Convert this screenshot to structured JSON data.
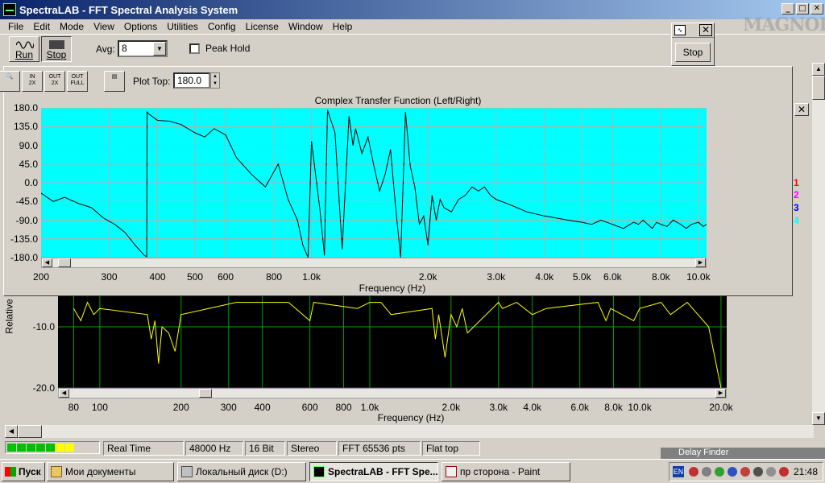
{
  "window": {
    "title": "SpectraLAB - FFT Spectral Analysis System"
  },
  "watermark": "MAGNOLIA",
  "menu": [
    "File",
    "Edit",
    "Mode",
    "View",
    "Options",
    "Utilities",
    "Config",
    "License",
    "Window",
    "Help"
  ],
  "toolbar": {
    "run_label": "Run",
    "stop_label": "Stop",
    "avg_label": "Avg:",
    "avg_value": "8",
    "peak_hold_label": "Peak Hold"
  },
  "mini_window": {
    "stop_label": "Stop"
  },
  "transfer_window": {
    "plot_top_label": "Plot Top:",
    "plot_top_value": "180.0",
    "buttons": [
      {
        "top": "IN",
        "bottom": "2X"
      },
      {
        "top": "OUT",
        "bottom": "2X"
      },
      {
        "top": "OUT",
        "bottom": "FULL"
      }
    ]
  },
  "chart_data": [
    {
      "type": "line",
      "title": "Complex Transfer Function (Left/Right)",
      "xlabel": "Frequency (Hz)",
      "x_scale": "log",
      "xlim": [
        200,
        10500
      ],
      "ylim": [
        -180,
        180
      ],
      "y_ticks": [
        "180.0",
        "135.0",
        "90.0",
        "45.0",
        "0.0",
        "-45.0",
        "-90.0",
        "-135.0",
        "-180.0"
      ],
      "x_ticks": [
        {
          "v": 200,
          "label": "200"
        },
        {
          "v": 300,
          "label": "300"
        },
        {
          "v": 400,
          "label": "400"
        },
        {
          "v": 500,
          "label": "500"
        },
        {
          "v": 600,
          "label": "600"
        },
        {
          "v": 800,
          "label": "800"
        },
        {
          "v": 1000,
          "label": "1.0k"
        },
        {
          "v": 2000,
          "label": "2.0k"
        },
        {
          "v": 3000,
          "label": "3.0k"
        },
        {
          "v": 4000,
          "label": "4.0k"
        },
        {
          "v": 5000,
          "label": "5.0k"
        },
        {
          "v": 6000,
          "label": "6.0k"
        },
        {
          "v": 8000,
          "label": "8.0k"
        },
        {
          "v": 10000,
          "label": "10.0k"
        }
      ],
      "series": [
        {
          "color": "#000000",
          "x": [
            200,
            215,
            230,
            250,
            270,
            290,
            310,
            330,
            350,
            370,
            375,
            376,
            380,
            400,
            430,
            460,
            500,
            530,
            560,
            600,
            640,
            700,
            760,
            820,
            870,
            920,
            950,
            980,
            1000,
            1050,
            1080,
            1100,
            1150,
            1200,
            1250,
            1280,
            1300,
            1350,
            1400,
            1450,
            1500,
            1550,
            1600,
            1650,
            1700,
            1750,
            1800,
            1850,
            1900,
            1950,
            2000,
            2050,
            2100,
            2150,
            2200,
            2300,
            2400,
            2500,
            2600,
            2700,
            2800,
            2900,
            3000,
            3200,
            3400,
            3600,
            3800,
            4000,
            4300,
            4600,
            5000,
            5300,
            5600,
            6000,
            6400,
            6800,
            7000,
            7200,
            7400,
            7600,
            7800,
            8000,
            8300,
            8600,
            9000,
            9300,
            9600,
            10000,
            10300,
            10500
          ],
          "y": [
            -25,
            -45,
            -35,
            -50,
            -60,
            -85,
            -100,
            -120,
            -150,
            -175,
            -178,
            170,
            165,
            150,
            148,
            140,
            120,
            110,
            130,
            115,
            60,
            20,
            -10,
            45,
            -40,
            -90,
            -150,
            -180,
            100,
            -60,
            -175,
            175,
            120,
            -160,
            160,
            90,
            130,
            70,
            110,
            40,
            -20,
            20,
            80,
            -60,
            -180,
            170,
            40,
            -10,
            -100,
            -80,
            -150,
            -30,
            -90,
            -40,
            -60,
            -70,
            -40,
            -30,
            -10,
            -20,
            -10,
            -30,
            -40,
            -50,
            -60,
            -70,
            -75,
            -80,
            -85,
            -90,
            -95,
            -100,
            -90,
            -100,
            -110,
            -95,
            -100,
            -90,
            -100,
            -110,
            -95,
            -100,
            -105,
            -90,
            -100,
            -110,
            -100,
            -95,
            -105,
            -100
          ]
        }
      ]
    },
    {
      "type": "line",
      "xlabel": "Frequency (Hz)",
      "ylabel": "Relative",
      "x_scale": "log",
      "xlim": [
        70,
        21000
      ],
      "ylim": [
        -20,
        -5
      ],
      "y_ticks": [
        {
          "v": -10,
          "label": "-10.0"
        },
        {
          "v": -20,
          "label": "-20.0"
        }
      ],
      "x_ticks": [
        {
          "v": 80,
          "label": "80"
        },
        {
          "v": 100,
          "label": "100"
        },
        {
          "v": 200,
          "label": "200"
        },
        {
          "v": 300,
          "label": "300"
        },
        {
          "v": 400,
          "label": "400"
        },
        {
          "v": 600,
          "label": "600"
        },
        {
          "v": 800,
          "label": "800"
        },
        {
          "v": 1000,
          "label": "1.0k"
        },
        {
          "v": 2000,
          "label": "2.0k"
        },
        {
          "v": 3000,
          "label": "3.0k"
        },
        {
          "v": 4000,
          "label": "4.0k"
        },
        {
          "v": 6000,
          "label": "6.0k"
        },
        {
          "v": 8000,
          "label": "8.0k"
        },
        {
          "v": 10000,
          "label": "10.0k"
        },
        {
          "v": 20000,
          "label": "20.0k"
        }
      ],
      "series": [
        {
          "color": "#ffff00",
          "x": [
            80,
            85,
            90,
            95,
            100,
            150,
            155,
            160,
            165,
            170,
            180,
            190,
            200,
            320,
            500,
            600,
            620,
            900,
            1000,
            1100,
            1200,
            1700,
            1750,
            1800,
            1900,
            2000,
            2100,
            2200,
            2300,
            3000,
            3100,
            3500,
            4000,
            4500,
            7000,
            7500,
            7800,
            9500,
            10000,
            12000,
            13000,
            15000,
            18000,
            20000
          ],
          "y": [
            -7,
            -9,
            -6,
            -8,
            -7,
            -8,
            -12,
            -9,
            -16,
            -10,
            -11,
            -14,
            -8,
            -6,
            -6,
            -9,
            -6,
            -7,
            -6,
            -6,
            -8,
            -7,
            -12,
            -8,
            -15,
            -8,
            -10,
            -7,
            -11,
            -6,
            -7,
            -6,
            -8,
            -7,
            -6,
            -9,
            -7,
            -9,
            -7,
            -6,
            -8,
            -6,
            -10,
            -20
          ]
        }
      ]
    }
  ],
  "channels": [
    "1",
    "2",
    "3",
    "4"
  ],
  "channel_colors": [
    "#ff0000",
    "#ff00ff",
    "#0000ff",
    "#00ffff"
  ],
  "status": {
    "mode": "Real Time",
    "sample_rate": "48000 Hz",
    "bits": "16 Bit",
    "channels": "Stereo",
    "fft_size": "FFT 65536 pts",
    "window": "Flat top",
    "level_colors": [
      "#00c000",
      "#00c000",
      "#00c000",
      "#00c000",
      "#00c000",
      "#ffff00",
      "#ffff00"
    ]
  },
  "delay_finder": "Delay Finder",
  "taskbar": {
    "start": "Пуск",
    "tasks": [
      "Мои документы",
      "Локальный диск (D:)",
      "SpectraLAB - FFT Spe...",
      "пр сторона - Paint"
    ],
    "lang": "EN",
    "clock": "21:48"
  }
}
